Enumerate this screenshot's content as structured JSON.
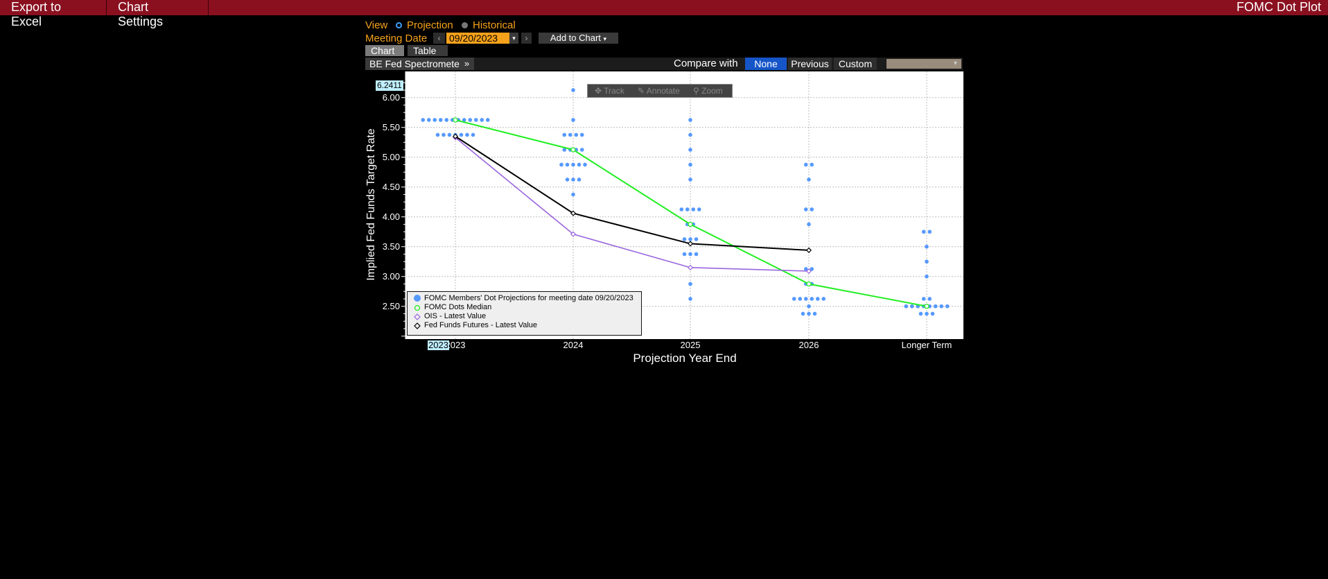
{
  "toolbar": {
    "export_label": "Export to Excel",
    "settings_label": "Chart Settings",
    "title": "FOMC Dot Plot"
  },
  "controls": {
    "view_label": "View",
    "view_options": [
      "Projection",
      "Historical"
    ],
    "view_selected": "Projection",
    "meeting_date_label": "Meeting Date",
    "meeting_date": "09/20/2023",
    "add_to_chart_label": "Add to Chart",
    "tabs": [
      "Chart",
      "Table"
    ],
    "active_tab": "Chart",
    "spectrometer_label": "BE Fed Spectrometer",
    "compare_label": "Compare with",
    "compare_options": [
      "None",
      "Previous",
      "Custom"
    ],
    "compare_selected": "None"
  },
  "chart_tools": [
    "Track",
    "Annotate",
    "Zoom"
  ],
  "highlights": {
    "y_value": "6.2411",
    "x_value": "2023"
  },
  "colors": {
    "dots": "#5599ff",
    "median": "#22ee22",
    "ois": "#9966dd",
    "fed_funds_futures": "#000000",
    "topbar": "#8a1020",
    "accent_orange": "#f7a21b"
  },
  "chart_data": {
    "type": "scatter",
    "xlabel": "Projection Year End",
    "ylabel": "Implied Fed Funds Target Rate",
    "categories": [
      "2023",
      "2024",
      "2025",
      "2026",
      "Longer Term"
    ],
    "y_ticks": [
      "6.00",
      "5.50",
      "5.00",
      "4.50",
      "4.00",
      "3.50",
      "3.00",
      "2.50"
    ],
    "ylim": [
      2.0,
      6.4
    ],
    "grid": true,
    "legend_position": "bottom-left",
    "legend": [
      "FOMC Members' Dot Projections for meeting date 09/20/2023",
      "FOMC Dots Median",
      "OIS - Latest Value",
      "Fed Funds Futures - Latest Value"
    ],
    "dots": [
      {
        "category": "2023",
        "counts": {
          "5.625": 12,
          "5.375": 7
        }
      },
      {
        "category": "2024",
        "counts": {
          "6.125": 1,
          "5.625": 1,
          "5.375": 4,
          "5.125": 4,
          "4.875": 5,
          "4.625": 3,
          "4.375": 1
        }
      },
      {
        "category": "2025",
        "counts": {
          "5.625": 1,
          "5.375": 1,
          "5.125": 1,
          "4.875": 1,
          "4.625": 1,
          "4.125": 4,
          "3.875": 2,
          "3.625": 3,
          "3.375": 3,
          "2.875": 1,
          "2.625": 1
        }
      },
      {
        "category": "2026",
        "counts": {
          "4.875": 2,
          "4.625": 1,
          "4.125": 2,
          "3.875": 1,
          "3.125": 2,
          "2.875": 2,
          "2.625": 6,
          "2.500": 1,
          "2.375": 3
        }
      },
      {
        "category": "Longer Term",
        "counts": {
          "3.750": 2,
          "3.500": 1,
          "3.250": 1,
          "3.000": 1,
          "2.625": 2,
          "2.500": 8,
          "2.375": 3
        }
      }
    ],
    "series": [
      {
        "name": "FOMC Dots Median",
        "values": [
          5.625,
          5.125,
          3.875,
          2.875,
          2.5
        ]
      },
      {
        "name": "OIS - Latest Value",
        "values": [
          5.33,
          3.71,
          3.15,
          3.09,
          null
        ]
      },
      {
        "name": "Fed Funds Futures - Latest Value",
        "values": [
          5.35,
          4.06,
          3.55,
          3.44,
          null
        ]
      }
    ]
  }
}
